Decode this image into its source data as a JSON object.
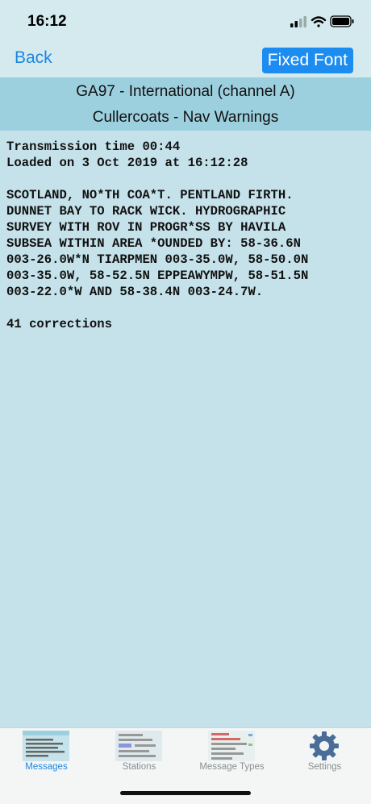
{
  "status": {
    "time": "16:12"
  },
  "nav": {
    "back_label": "Back",
    "fixed_font_label": "Fixed Font"
  },
  "header": {
    "station_line": "GA97 - International (channel A)",
    "title_line": "Cullercoats - Nav Warnings"
  },
  "message": {
    "transmission": "Transmission time 00:44",
    "loaded": "Loaded on 3 Oct 2019 at 16:12:28",
    "body_lines": [
      "SCOTLAND, NO*TH COA*T. PENTLAND FIRTH.",
      "DUNNET BAY TO RACK WICK. HYDROGRAPHIC",
      "SURVEY WITH ROV IN PROGR*SS BY HAVILA",
      "SUBSEA WITHIN AREA *OUNDED BY: 58-36.6N",
      "003-26.0W*N TIARPMEN 003-35.0W, 58-50.0N",
      "003-35.0W, 58-52.5N EPPEAWYMPW, 58-51.5N",
      "003-22.0*W AND 58-38.4N 003-24.7W."
    ],
    "corrections": "41 corrections"
  },
  "tabs": [
    {
      "label": "Messages",
      "icon": "messages-icon",
      "active": true
    },
    {
      "label": "Stations",
      "icon": "stations-icon",
      "active": false
    },
    {
      "label": "Message Types",
      "icon": "message-types-icon",
      "active": false
    },
    {
      "label": "Settings",
      "icon": "gear-icon",
      "active": false
    }
  ],
  "colors": {
    "accent": "#1d86e0",
    "header_band": "#9dd0df",
    "background": "#c4e2e9"
  }
}
